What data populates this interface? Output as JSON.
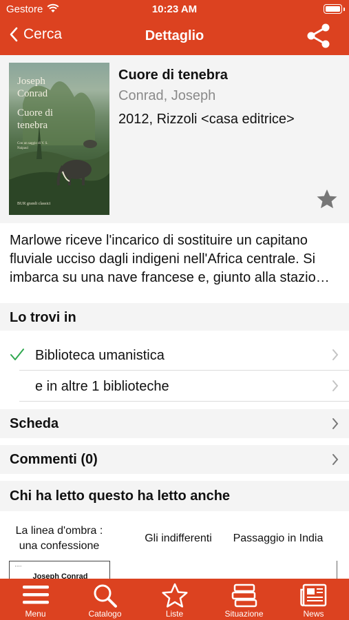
{
  "status": {
    "carrier": "Gestore",
    "time": "10:23 AM"
  },
  "nav": {
    "back_label": "Cerca",
    "title": "Dettaglio"
  },
  "book": {
    "title": "Cuore di tenebra",
    "author": "Conrad, Joseph",
    "publication": "2012, Rizzoli <casa editrice>",
    "cover": {
      "author": "Joseph Conrad",
      "title": "Cuore di tenebra",
      "subtitle": "Con un saggio di V. S. Naipaul",
      "imprint": "BUR grandi classici"
    }
  },
  "description": "Marlowe riceve l'incarico di sostituire un capitano fluviale ucciso dagli indigeni nell'Africa centrale. Si imbarca su una nave francese e, giunto alla stazio…",
  "availability": {
    "header": "Lo trovi in",
    "rows": [
      {
        "label": "Biblioteca umanistica"
      },
      {
        "label": "e in altre 1 biblioteche"
      }
    ]
  },
  "sections": {
    "scheda": "Scheda",
    "comments": "Commenti (0)",
    "also_read": "Chi ha letto questo ha letto anche"
  },
  "recommendations": [
    {
      "title": "La linea d'ombra : una confessione"
    },
    {
      "title": "Gli indifferenti"
    },
    {
      "title": "Passaggio in India"
    }
  ],
  "mini_cover": {
    "author": "Joseph Conrad"
  },
  "tabbar": [
    {
      "label": "Menu",
      "icon": "menu-icon"
    },
    {
      "label": "Catalogo",
      "icon": "search-icon"
    },
    {
      "label": "Liste",
      "icon": "star-icon"
    },
    {
      "label": "Situazione",
      "icon": "books-stack-icon"
    },
    {
      "label": "News",
      "icon": "newspaper-icon"
    }
  ],
  "colors": {
    "accent": "#dc4220",
    "check": "#2fa84f"
  }
}
